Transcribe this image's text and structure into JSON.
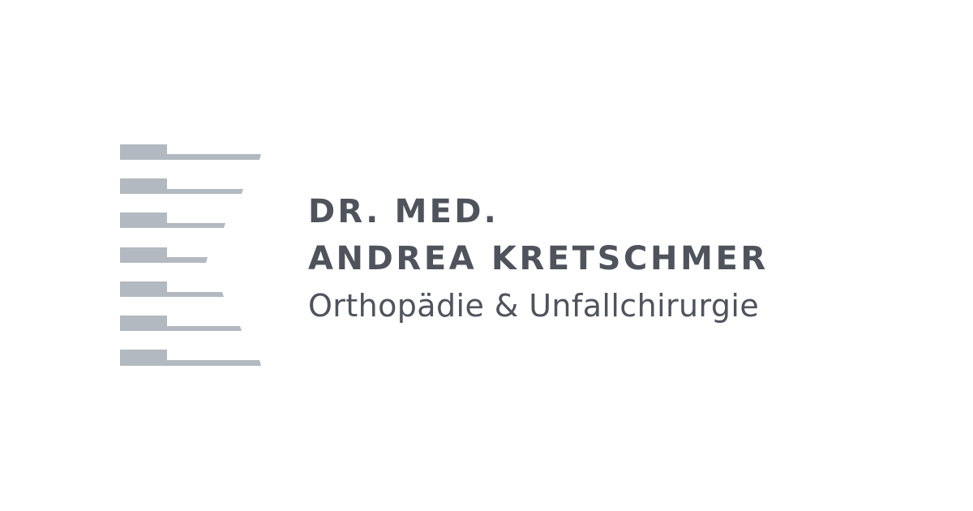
{
  "logo": {
    "title_line_1": "DR. MED.",
    "title_line_2": "ANDREA KRETSCHMER",
    "subtitle": "Orthopädie & Unfallchirurgie",
    "text_color": "#4f535c",
    "mark_color": "#b2b9c0",
    "mark_icon": "spine-vertebrae-icon"
  }
}
